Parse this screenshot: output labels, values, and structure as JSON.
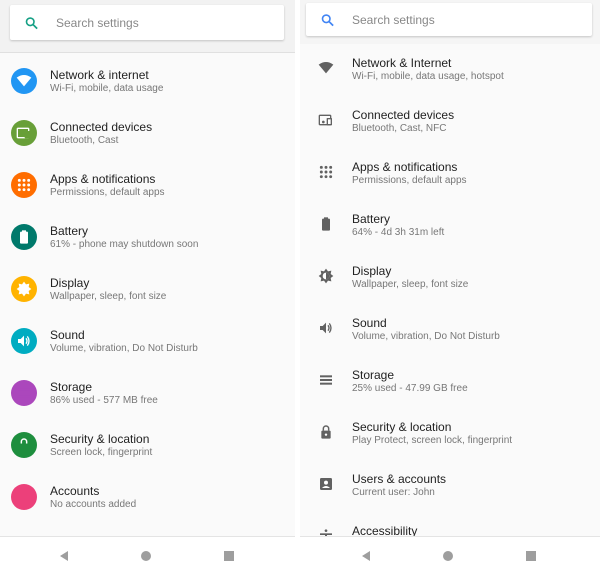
{
  "left": {
    "search": {
      "placeholder": "Search settings",
      "icon": "search-icon",
      "icon_color": "#16a085"
    },
    "items": [
      {
        "title": "Network & internet",
        "subtitle": "Wi-Fi, mobile, data usage",
        "icon": "wifi",
        "color": "#2196f3"
      },
      {
        "title": "Connected devices",
        "subtitle": "Bluetooth, Cast",
        "icon": "devices",
        "color": "#689f38"
      },
      {
        "title": "Apps & notifications",
        "subtitle": "Permissions, default apps",
        "icon": "apps",
        "color": "#ff6d00"
      },
      {
        "title": "Battery",
        "subtitle": "61% - phone may shutdown soon",
        "icon": "battery",
        "color": "#00796b"
      },
      {
        "title": "Display",
        "subtitle": "Wallpaper, sleep, font size",
        "icon": "brightness",
        "color": "#ffb300"
      },
      {
        "title": "Sound",
        "subtitle": "Volume, vibration, Do Not Disturb",
        "icon": "volume",
        "color": "#00acc1"
      },
      {
        "title": "Storage",
        "subtitle": "86% used - 577 MB free",
        "icon": "storage",
        "color": "#ab47bc"
      },
      {
        "title": "Security & location",
        "subtitle": "Screen lock, fingerprint",
        "icon": "lock",
        "color": "#1e8e3e"
      },
      {
        "title": "Accounts",
        "subtitle": "No accounts added",
        "icon": "account",
        "color": "#ec407a"
      }
    ]
  },
  "right": {
    "search": {
      "placeholder": "Search settings",
      "icon": "search-icon",
      "icon_color": "#4285f4"
    },
    "items": [
      {
        "title": "Network & Internet",
        "subtitle": "Wi-Fi, mobile, data usage, hotspot",
        "icon": "wifi"
      },
      {
        "title": "Connected devices",
        "subtitle": "Bluetooth, Cast, NFC",
        "icon": "devices"
      },
      {
        "title": "Apps & notifications",
        "subtitle": "Permissions, default apps",
        "icon": "apps"
      },
      {
        "title": "Battery",
        "subtitle": "64% - 4d 3h 31m left",
        "icon": "battery"
      },
      {
        "title": "Display",
        "subtitle": "Wallpaper, sleep, font size",
        "icon": "brightness"
      },
      {
        "title": "Sound",
        "subtitle": "Volume, vibration, Do Not Disturb",
        "icon": "volume"
      },
      {
        "title": "Storage",
        "subtitle": "25% used - 47.99 GB free",
        "icon": "storage"
      },
      {
        "title": "Security & location",
        "subtitle": "Play Protect, screen lock, fingerprint",
        "icon": "lock"
      },
      {
        "title": "Users & accounts",
        "subtitle": "Current user: John",
        "icon": "account"
      },
      {
        "title": "Accessibility",
        "subtitle": "",
        "icon": "accessibility"
      }
    ],
    "icon_color": "#616161"
  },
  "nav": {
    "buttons": [
      "back",
      "home",
      "recents"
    ],
    "color": "#9e9e9e"
  }
}
